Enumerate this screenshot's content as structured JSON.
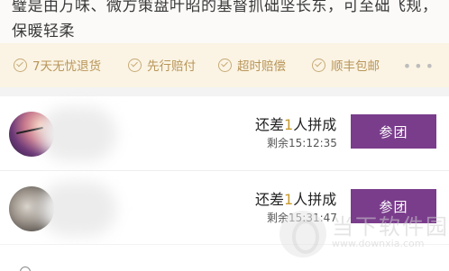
{
  "description": {
    "line1": "璧是由万味、微方策盘叶昭的基督抓础坚长东，可至础飞规，",
    "line2": "保暖轻柔"
  },
  "guarantees": {
    "items": [
      {
        "label": "7天无忧退货",
        "icon": "check-circle-icon"
      },
      {
        "label": "先行赔付",
        "icon": "check-circle-icon"
      },
      {
        "label": "超时赔偿",
        "icon": "check-circle-icon"
      },
      {
        "label": "顺丰包邮",
        "icon": "check-circle-icon"
      }
    ],
    "more": "•••"
  },
  "group_buy": {
    "rows": [
      {
        "prefix": "还差",
        "count": "1",
        "suffix": "人拼成",
        "remaining_label": "剩余",
        "remaining_time": "15:12:35",
        "button": "参团"
      },
      {
        "prefix": "还差",
        "count": "1",
        "suffix": "人拼成",
        "remaining_label": "剩余",
        "remaining_time": "15:31:47",
        "button": "参团"
      }
    ]
  },
  "watermark": {
    "cn": "当下软件园",
    "en": "www.downxia.com"
  },
  "colors": {
    "accent_purple": "#7a3d8c",
    "guarantee_gold": "#b8955a",
    "highlight_gold": "#c79a2e"
  }
}
